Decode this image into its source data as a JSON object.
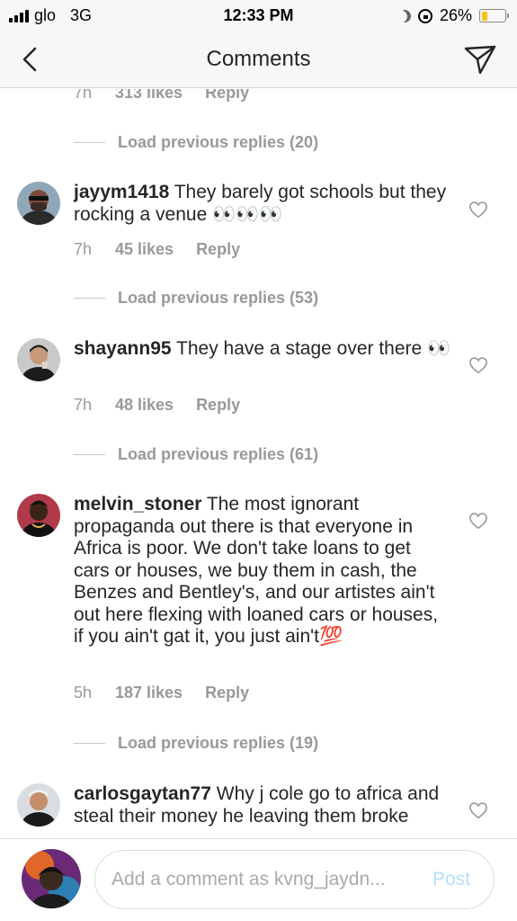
{
  "status_bar": {
    "carrier": "glo",
    "network": "3G",
    "time": "12:33 PM",
    "battery_percent": "26%",
    "battery_level": 0.26,
    "battery_color": "#f5c518"
  },
  "header": {
    "title": "Comments",
    "back_icon": "chevron-left-icon",
    "send_icon": "paper-plane-icon"
  },
  "top_partial": {
    "time": "7h",
    "likes": "313 likes",
    "reply": "Reply"
  },
  "threads": [
    {
      "load_previous": "Load previous replies (20)",
      "username": "jayym1418",
      "text": "They barely got schools but they rocking a venue 👀👀👀",
      "time": "7h",
      "likes": "45 likes",
      "reply": "Reply"
    },
    {
      "load_previous": "Load previous replies (53)",
      "username": "shayann95",
      "text": "They have a stage over there 👀",
      "time": "7h",
      "likes": "48 likes",
      "reply": "Reply"
    },
    {
      "load_previous": "Load previous replies (61)",
      "username": "melvin_stoner",
      "text": "The most ignorant propaganda out there is that everyone in Africa is poor. We don't take loans to get cars or houses, we buy them in cash, the Benzes and Bentley's, and our artistes ain't out here flexing with loaned cars or houses, if you ain't gat it, you just ain't💯",
      "time": "5h",
      "likes": "187 likes",
      "reply": "Reply"
    },
    {
      "load_previous": "Load previous replies (19)",
      "username": "carlosgaytan77",
      "text": "Why j cole go to africa and steal their money he leaving them broke"
    }
  ],
  "composer": {
    "placeholder": "Add a comment as kvng_jaydn...",
    "post_label": "Post",
    "post_color": "#b2dffc"
  }
}
